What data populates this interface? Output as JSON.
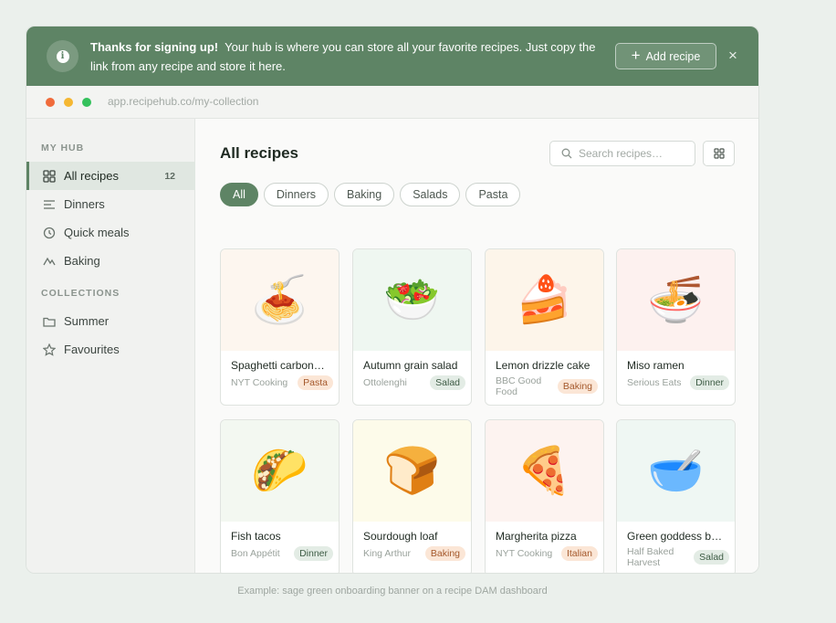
{
  "banner": {
    "icon": "info-icon",
    "strong": "Thanks for signing up!",
    "message": "Your hub is where you can store all your favorite recipes. Just copy the link from any recipe and store it here.",
    "add_label": "Add recipe",
    "close_glyph": "×"
  },
  "window": {
    "url": "app.recipehub.co/my-collection",
    "dots": [
      "#f06b3b",
      "#f5b732",
      "#34c15c"
    ]
  },
  "sidebar": {
    "hub_label": "MY HUB",
    "hub_items": [
      {
        "label": "All recipes",
        "count": "12",
        "icon": "grid-icon",
        "active": true
      },
      {
        "label": "Dinners",
        "icon": "list-icon"
      },
      {
        "label": "Quick meals",
        "icon": "clock-icon"
      },
      {
        "label": "Baking",
        "icon": "mountain-icon"
      }
    ],
    "collections_label": "COLLECTIONS",
    "collection_items": [
      {
        "label": "Summer",
        "icon": "folder-icon"
      },
      {
        "label": "Favourites",
        "icon": "star-icon"
      }
    ]
  },
  "main": {
    "title": "All recipes",
    "search_placeholder": "Search recipes…",
    "filters": [
      "All",
      "Dinners",
      "Baking",
      "Salads",
      "Pasta"
    ],
    "active_filter": "All",
    "recipes": [
      {
        "title": "Spaghetti carbon…",
        "source": "NYT Cooking",
        "tag": "Pasta",
        "tag_style": "orange",
        "emoji": "🍝",
        "bg": "#fdf6ef"
      },
      {
        "title": "Autumn grain salad",
        "source": "Ottolenghi",
        "tag": "Salad",
        "tag_style": "green",
        "emoji": "🥗",
        "bg": "#eff7f1"
      },
      {
        "title": "Lemon drizzle cake",
        "source": "BBC Good Food",
        "tag": "Baking",
        "tag_style": "orange",
        "emoji": "🍰",
        "bg": "#fdf5ea"
      },
      {
        "title": "Miso ramen",
        "source": "Serious Eats",
        "tag": "Dinner",
        "tag_style": "green",
        "emoji": "🍜",
        "bg": "#fdf1ef"
      },
      {
        "title": "Fish tacos",
        "source": "Bon Appétit",
        "tag": "Dinner",
        "tag_style": "green",
        "emoji": "🌮",
        "bg": "#f3f8f1"
      },
      {
        "title": "Sourdough loaf",
        "source": "King Arthur",
        "tag": "Baking",
        "tag_style": "orange",
        "emoji": "🍞",
        "bg": "#fdfbea"
      },
      {
        "title": "Margherita pizza",
        "source": "NYT Cooking",
        "tag": "Italian",
        "tag_style": "orange",
        "emoji": "🍕",
        "bg": "#fdf3f0"
      },
      {
        "title": "Green goddess b…",
        "source": "Half Baked Harvest",
        "tag": "Salad",
        "tag_style": "green",
        "emoji": "🥣",
        "bg": "#eff7f3"
      }
    ]
  },
  "caption": "Example: sage green onboarding banner on a recipe DAM dashboard",
  "colors": {
    "accent": "#5e8465",
    "tag_orange_bg": "#fbe6d6",
    "tag_orange_fg": "#a4582b",
    "tag_green_bg": "#e3ece5",
    "tag_green_fg": "#3e5c45"
  }
}
